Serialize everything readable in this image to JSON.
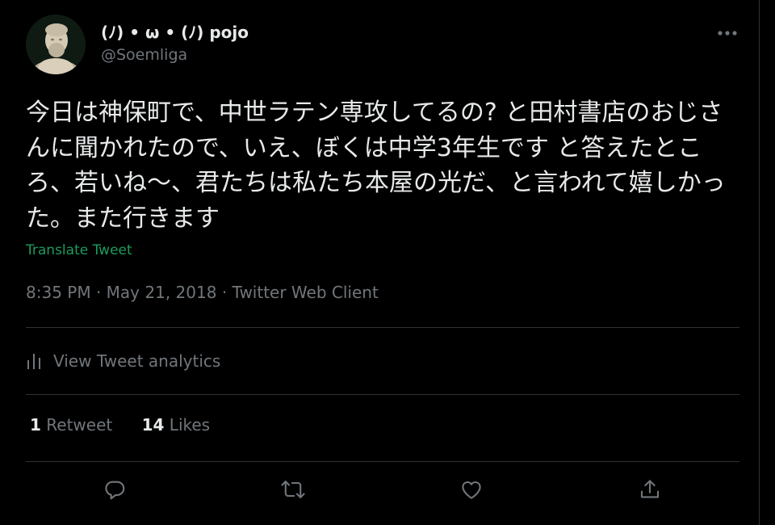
{
  "tweet": {
    "display_name": "(ﾉ) • ω • (ﾉ) pojo",
    "handle": "@Soemliga",
    "text": "今日は神保町で、中世ラテン専攻してるの? と田村書店のおじさんに聞かれたので、いえ、ぼくは中学3年生です と答えたところ、若いね〜、君たちは私たち本屋の光だ、と言われて嬉しかった。また行きます",
    "translate_label": "Translate Tweet",
    "time": "8:35 PM",
    "date": "May 21, 2018",
    "client": "Twitter Web Client",
    "separator": "·",
    "analytics_label": "View Tweet analytics",
    "retweets": {
      "count": "1",
      "label": "Retweet"
    },
    "likes": {
      "count": "14",
      "label": "Likes"
    }
  },
  "icons": {
    "more": "more-horizontal-icon",
    "analytics": "bar-chart-icon",
    "reply": "reply-icon",
    "retweet": "retweet-icon",
    "like": "heart-icon",
    "share": "share-icon"
  },
  "colors": {
    "background": "#000000",
    "text_primary": "#e7e9ea",
    "text_secondary": "#71767b",
    "link": "#1d9b5e",
    "divider": "#2f3336"
  }
}
